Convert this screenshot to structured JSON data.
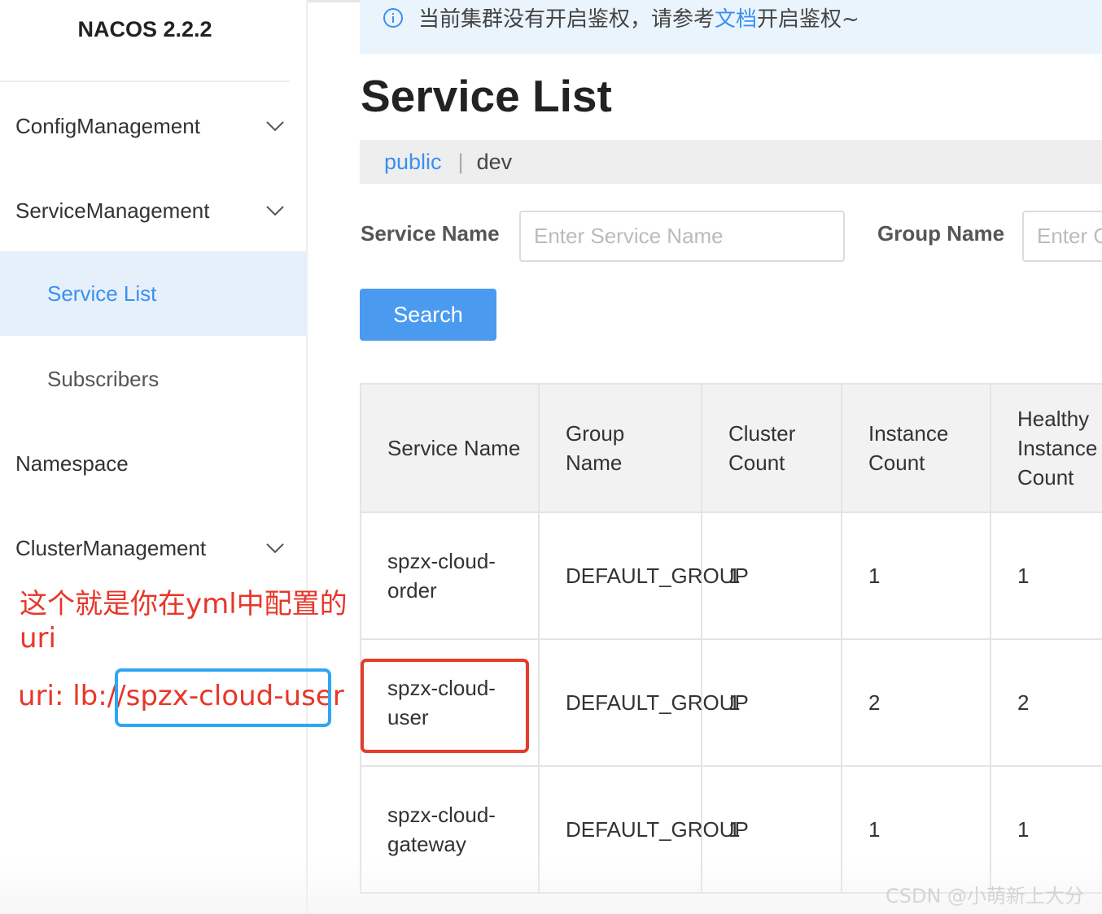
{
  "sidebar": {
    "logo": "NACOS 2.2.2",
    "items": [
      {
        "label": "ConfigManagement"
      },
      {
        "label": "ServiceManagement"
      },
      {
        "label": "Service List"
      },
      {
        "label": "Subscribers"
      },
      {
        "label": "Namespace"
      },
      {
        "label": "ClusterManagement"
      }
    ]
  },
  "notice": {
    "prefix": "当前集群没有开启鉴权，请参考",
    "link": "文档",
    "suffix": "开启鉴权~"
  },
  "page": {
    "title": "Service List"
  },
  "namespaces": {
    "active": "public",
    "separator": "|",
    "other": "dev"
  },
  "filters": {
    "service_name_label": "Service Name",
    "service_name_placeholder": "Enter Service Name",
    "group_name_label": "Group Name",
    "group_name_placeholder": "Enter Group Name"
  },
  "search_label": "Search",
  "table": {
    "headers": [
      "Service Name",
      "Group Name",
      "Cluster Count",
      "Instance Count",
      "Healthy Instance Count"
    ],
    "rows": [
      [
        "spzx-cloud-order",
        "DEFAULT_GROUP",
        "1",
        "1",
        "1"
      ],
      [
        "spzx-cloud-user",
        "DEFAULT_GROUP",
        "1",
        "2",
        "2"
      ],
      [
        "spzx-cloud-gateway",
        "DEFAULT_GROUP",
        "1",
        "1",
        "1"
      ]
    ]
  },
  "annotation": {
    "line1": "这个就是你在yml中配置的uri",
    "uri_prefix": "uri: lb://",
    "uri_value": "spzx-cloud-user"
  },
  "watermark": "CSDN @小萌新上大分",
  "colors": {
    "accent": "#3b8ff1",
    "annotation": "#e8362a",
    "highlight_blue": "#2ea6f4",
    "highlight_red": "#e33d2b"
  }
}
